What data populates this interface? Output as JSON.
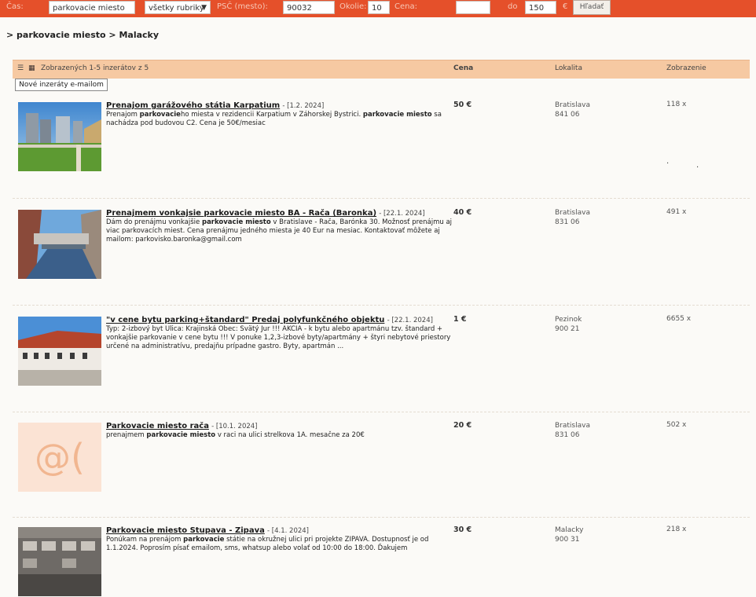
{
  "search": {
    "cat_label": "Čas:",
    "keyword_value": "parkovacie miesto",
    "category_value": "všetky rubriky",
    "psc_label": "PSČ (mesto):",
    "psc_value": "90032",
    "radius_label": "Okolie:",
    "radius_value": "10",
    "price_label": "Cena:",
    "price_from": "",
    "price_to_label": "do",
    "price_to_value": "150",
    "currency": "€",
    "search_button": "Hľadať"
  },
  "breadcrumb": "> parkovacie miesto > Malacky",
  "table": {
    "summary": "Zobrazených 1-5 inzerátov z 5",
    "col_price": "Cena",
    "col_location": "Lokalita",
    "col_views": "Zobrazenie",
    "email_button": "Nové inzeráty e-mailom"
  },
  "listings": [
    {
      "title": "Prenajom garážového státia Karpatium",
      "date": "- [1.2. 2024]",
      "desc_html": "Prenajom <b>parkovacie</b>ho miesta v rezidencii Karpatium v Záhorskej Bystrici. <b>parkovacie miesto</b> sa nachádza pod budovou C2. Cena je 50€/mesiac",
      "price": "50 €",
      "city": "Bratislava",
      "zip": "841 06",
      "views": "118 x"
    },
    {
      "title": "Prenajmem vonkajsie parkovacie miesto BA - Rača (Baronka)",
      "date": "- [22.1. 2024]",
      "desc_html": "Dám do prenájmu vonkajšie <b>parkovacie miesto</b> v Bratislave - Rača, Barónka 30. Možnosť prenájmu aj viac parkovacích miest. Cena prenájmu jedného miesta je 40 Eur na mesiac. Kontaktovať môžete aj mailom: parkovisko.baronka@gmail.com",
      "price": "40 €",
      "city": "Bratislava",
      "zip": "831 06",
      "views": "491 x"
    },
    {
      "title": "\"v cene bytu parking+štandard\" Predaj polyfunkčného objektu",
      "date": "- [22.1. 2024]",
      "desc_html": "Typ: 2-izbový byt Ulica: Krajinská Obec: Svätý Jur !!! AKCIA - k bytu alebo apartmánu tzv. štandard + vonkajšie parkovanie v cene bytu !!! V ponuke 1,2,3-izbové byty/apartmány + štyri nebytové priestory určené na administratívu, predajňu prípadne gastro. Byty, apartmán ...",
      "price": "1 €",
      "city": "Pezinok",
      "zip": "900 21",
      "views": "6655 x"
    },
    {
      "title": "Parkovacie miesto rača",
      "date": "- [10.1. 2024]",
      "desc_html": "prenajmem <b>parkovacie miesto</b> v raci na ulici strelkova 1A. mesačne za 20€",
      "price": "20 €",
      "city": "Bratislava",
      "zip": "831 06",
      "views": "502 x"
    },
    {
      "title": "Parkovacie miesto Stupava - Zipava",
      "date": "- [4.1. 2024]",
      "desc_html": "Ponúkam na prenájom <b>parkovacie</b> státie na okružnej ulici pri projekte ZIPAVA. Dostupnosť je od 1.1.2024. Poprosím písať emailom, sms, whatsup alebo volať od 10:00 do 18:00. Ďakujem",
      "price": "30 €",
      "city": "Malacky",
      "zip": "900 31",
      "views": "218 x"
    }
  ],
  "placeholder_text": "@(",
  "colors": {
    "topbar": "#e5502a",
    "table_header": "#f6c9a2",
    "page_bg": "#fbfaf7"
  }
}
